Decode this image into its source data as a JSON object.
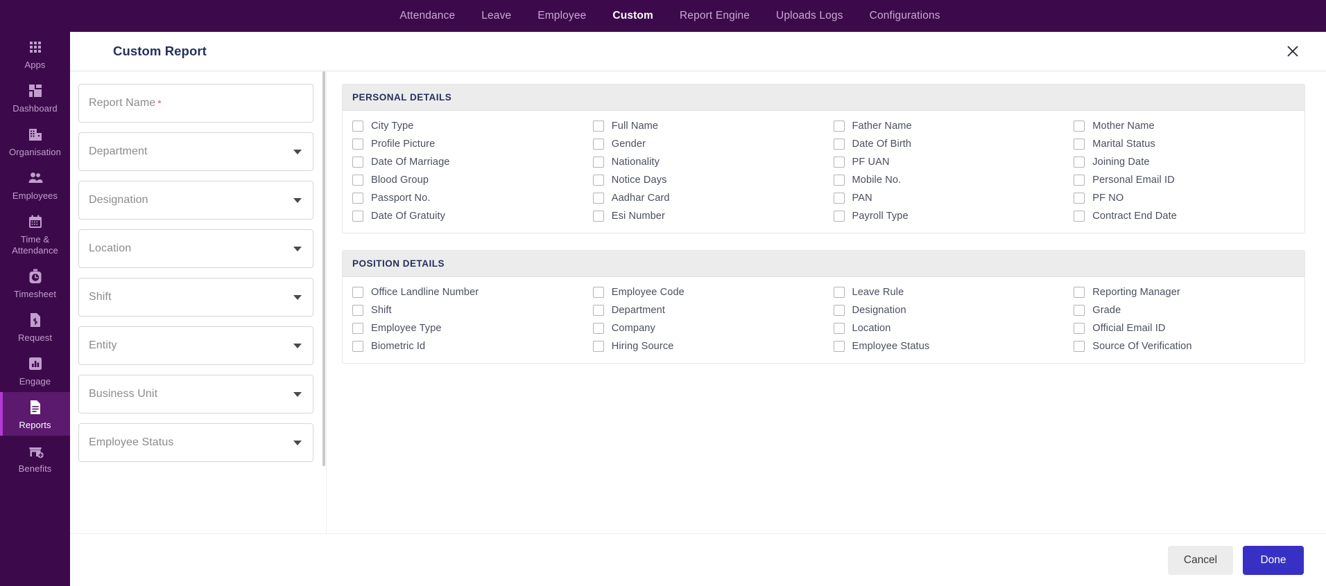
{
  "topnav": {
    "items": [
      {
        "label": "Attendance",
        "active": false
      },
      {
        "label": "Leave",
        "active": false
      },
      {
        "label": "Employee",
        "active": false
      },
      {
        "label": "Custom",
        "active": true
      },
      {
        "label": "Report Engine",
        "active": false
      },
      {
        "label": "Uploads Logs",
        "active": false
      },
      {
        "label": "Configurations",
        "active": false
      }
    ]
  },
  "sidebar": {
    "items": [
      {
        "label": "Apps",
        "icon": "grid-apps-icon",
        "active": false
      },
      {
        "label": "Dashboard",
        "icon": "dashboard-icon",
        "active": false
      },
      {
        "label": "Organisation",
        "icon": "building-icon",
        "active": false
      },
      {
        "label": "Employees",
        "icon": "people-icon",
        "active": false
      },
      {
        "label": "Time & Attendance",
        "icon": "calendar-icon",
        "active": false
      },
      {
        "label": "Timesheet",
        "icon": "stopwatch-icon",
        "active": false
      },
      {
        "label": "Request",
        "icon": "money-document-icon",
        "active": false
      },
      {
        "label": "Engage",
        "icon": "bar-chart-icon",
        "active": false
      },
      {
        "label": "Reports",
        "icon": "document-lines-icon",
        "active": true
      },
      {
        "label": "Benefits",
        "icon": "store-plus-icon",
        "active": false
      }
    ]
  },
  "modal": {
    "title": "Custom Report",
    "close_icon": "close-icon"
  },
  "form": {
    "fields": [
      {
        "label": "Report Name",
        "required": true,
        "type": "text",
        "value": ""
      },
      {
        "label": "Department",
        "required": false,
        "type": "select",
        "value": ""
      },
      {
        "label": "Designation",
        "required": false,
        "type": "select",
        "value": ""
      },
      {
        "label": "Location",
        "required": false,
        "type": "select",
        "value": ""
      },
      {
        "label": "Shift",
        "required": false,
        "type": "select",
        "value": ""
      },
      {
        "label": "Entity",
        "required": false,
        "type": "select",
        "value": ""
      },
      {
        "label": "Business Unit",
        "required": false,
        "type": "select",
        "value": ""
      },
      {
        "label": "Employee Status",
        "required": false,
        "type": "select",
        "value": ""
      }
    ]
  },
  "sections": [
    {
      "title": "PERSONAL DETAILS",
      "fields": [
        {
          "label": "City Type",
          "checked": false
        },
        {
          "label": "Full Name",
          "checked": false
        },
        {
          "label": "Father Name",
          "checked": false
        },
        {
          "label": "Mother Name",
          "checked": false
        },
        {
          "label": "Profile Picture",
          "checked": false
        },
        {
          "label": "Gender",
          "checked": false
        },
        {
          "label": "Date Of Birth",
          "checked": false
        },
        {
          "label": "Marital Status",
          "checked": false
        },
        {
          "label": "Date Of Marriage",
          "checked": false
        },
        {
          "label": "Nationality",
          "checked": false
        },
        {
          "label": "PF UAN",
          "checked": false
        },
        {
          "label": "Joining Date",
          "checked": false
        },
        {
          "label": "Blood Group",
          "checked": false
        },
        {
          "label": "Notice Days",
          "checked": false
        },
        {
          "label": "Mobile No.",
          "checked": false
        },
        {
          "label": "Personal Email ID",
          "checked": false
        },
        {
          "label": "Passport No.",
          "checked": false
        },
        {
          "label": "Aadhar Card",
          "checked": false
        },
        {
          "label": "PAN",
          "checked": false
        },
        {
          "label": "PF NO",
          "checked": false
        },
        {
          "label": "Date Of Gratuity",
          "checked": false
        },
        {
          "label": "Esi Number",
          "checked": false
        },
        {
          "label": "Payroll Type",
          "checked": false
        },
        {
          "label": "Contract End Date",
          "checked": false
        }
      ]
    },
    {
      "title": "POSITION DETAILS",
      "fields": [
        {
          "label": "Office Landline Number",
          "checked": false
        },
        {
          "label": "Employee Code",
          "checked": false
        },
        {
          "label": "Leave Rule",
          "checked": false
        },
        {
          "label": "Reporting Manager",
          "checked": false
        },
        {
          "label": "Shift",
          "checked": false
        },
        {
          "label": "Department",
          "checked": false
        },
        {
          "label": "Designation",
          "checked": false
        },
        {
          "label": "Grade",
          "checked": false
        },
        {
          "label": "Employee Type",
          "checked": false
        },
        {
          "label": "Company",
          "checked": false
        },
        {
          "label": "Location",
          "checked": false
        },
        {
          "label": "Official Email ID",
          "checked": false
        },
        {
          "label": "Biometric Id",
          "checked": false
        },
        {
          "label": "Hiring Source",
          "checked": false
        },
        {
          "label": "Employee Status",
          "checked": false
        },
        {
          "label": "Source Of Verification",
          "checked": false
        }
      ]
    }
  ],
  "footer": {
    "cancel_label": "Cancel",
    "done_label": "Done"
  },
  "colors": {
    "sidebar_bg": "#3c0a4a",
    "sidebar_active": "#5b1a6e",
    "accent_primary": "#3730c4",
    "section_head_bg": "#ececec",
    "heading_text": "#24305e",
    "required_star": "#e2574c"
  }
}
